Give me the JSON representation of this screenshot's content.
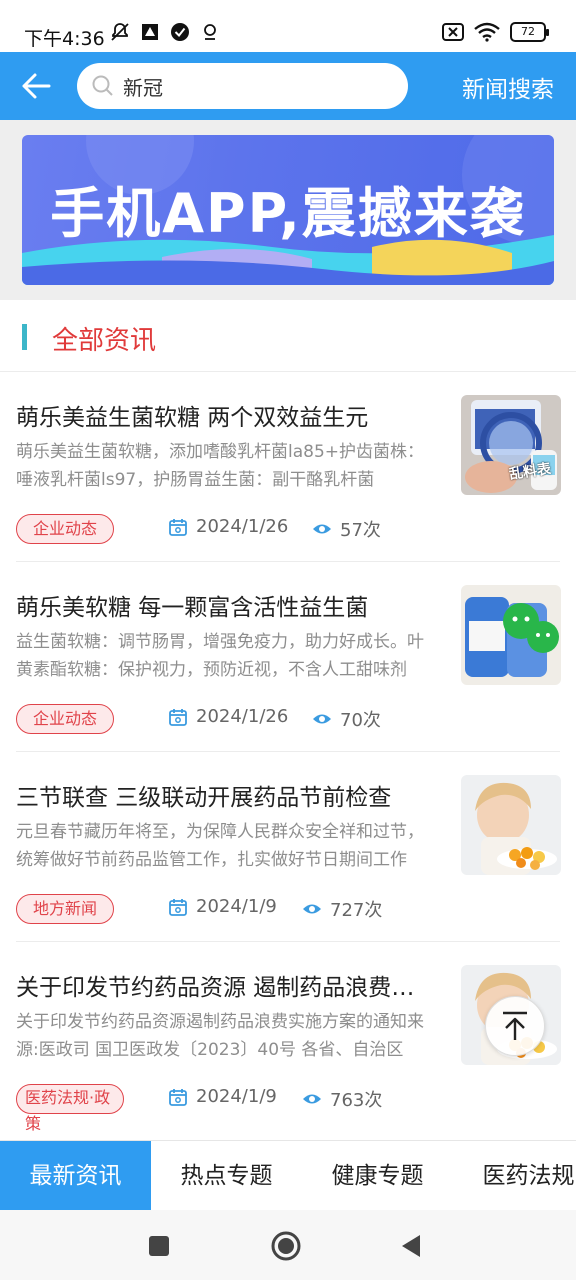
{
  "status_bar": {
    "time": "下午4:36",
    "battery": "72"
  },
  "header": {
    "search_value": "新冠",
    "search_button": "新闻搜索"
  },
  "banner": {
    "text": "手机APP,震撼来袭"
  },
  "section": {
    "title": "全部资讯"
  },
  "news": [
    {
      "title": "萌乐美益生菌软糖 两个双效益生元",
      "desc": "萌乐美益生菌软糖，添加嗜酸乳杆菌la85+护齿菌株：唾液乳杆菌ls97，护肠胃益生菌：副干酪乳杆菌",
      "tag": "企业动态",
      "date": "2024/1/26",
      "views": "57次",
      "thumb_label": "乱料表"
    },
    {
      "title": "萌乐美软糖 每一颗富含活性益生菌",
      "desc": "益生菌软糖：调节肠胃，增强免疫力，助力好成长。叶黄素酯软糖：保护视力，预防近视，不含人工甜味剂",
      "tag": "企业动态",
      "date": "2024/1/26",
      "views": "70次"
    },
    {
      "title": "三节联查 三级联动开展药品节前检查",
      "desc": "元旦春节藏历年将至，为保障人民群众安全祥和过节，统筹做好节前药品监管工作，扎实做好节日期间工作",
      "tag": "地方新闻",
      "date": "2024/1/9",
      "views": "727次"
    },
    {
      "title": "关于印发节约药品资源 遏制药品浪费实施方案的通知",
      "desc": "关于印发节约药品资源遏制药品浪费实施方案的通知来源:医政司 国卫医政发〔2023〕40号 各省、自治区",
      "tag": "医药法规·政策",
      "date": "2024/1/9",
      "views": "763次"
    }
  ],
  "tabs": [
    "最新资讯",
    "热点专题",
    "健康专题",
    "医药法规"
  ],
  "colors": {
    "primary": "#2f9cf1",
    "accent_red": "#e03a3a",
    "section_bar": "#3cb6c9"
  }
}
